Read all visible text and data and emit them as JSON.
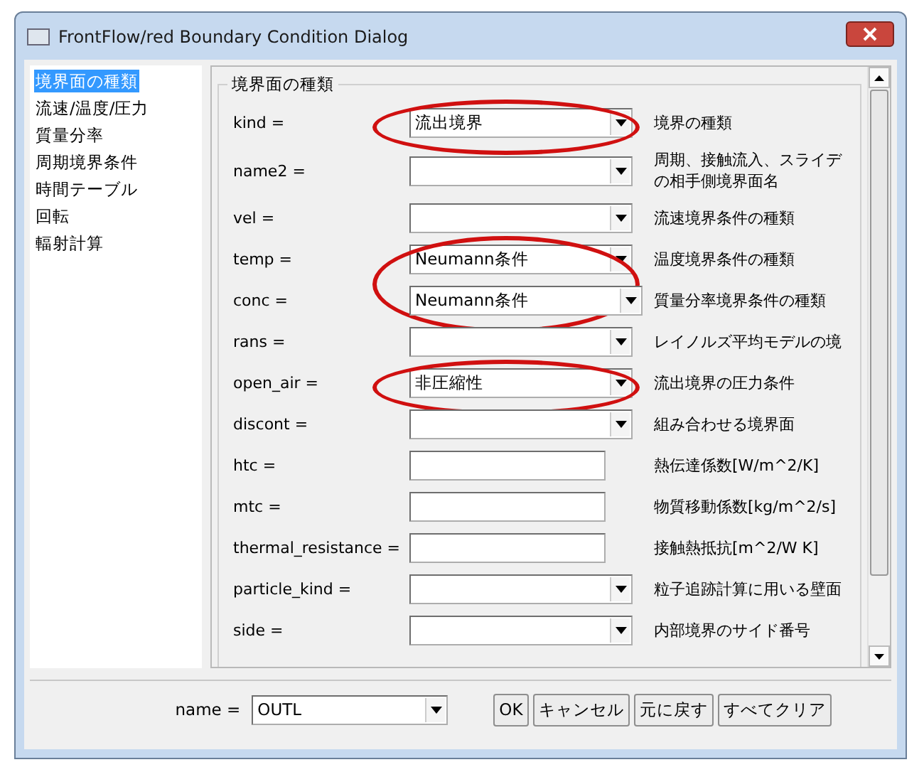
{
  "window": {
    "title": "FrontFlow/red Boundary Condition Dialog"
  },
  "sidebar": {
    "items": [
      {
        "label": "境界面の種類",
        "selected": true
      },
      {
        "label": "流速/温度/圧力",
        "selected": false
      },
      {
        "label": "質量分率",
        "selected": false
      },
      {
        "label": "周期境界条件",
        "selected": false
      },
      {
        "label": "時間テーブル",
        "selected": false
      },
      {
        "label": "回転",
        "selected": false
      },
      {
        "label": "輻射計算",
        "selected": false
      }
    ]
  },
  "group": {
    "title": "境界面の種類",
    "rows": [
      {
        "label": "kind =",
        "kind": "combo",
        "value": "流出境界",
        "description": "境界の種類",
        "circled": true
      },
      {
        "label": "name2 =",
        "kind": "combo",
        "description": "周期、接触流入、スライデの相手側境界面名",
        "circled": false
      },
      {
        "label": "vel =",
        "kind": "combo",
        "description": "流速境界条件の種類",
        "circled": false
      },
      {
        "label": "temp =",
        "kind": "combo",
        "value": "Neumann条件",
        "description": "温度境界条件の種類",
        "circled": true
      },
      {
        "label": "conc =",
        "kind": "combo_wide",
        "value": "Neumann条件",
        "description": "質量分率境界条件の種類",
        "circled": true
      },
      {
        "label": "rans =",
        "kind": "combo",
        "description": "レイノルズ平均モデルの境",
        "circled": false
      },
      {
        "label": "open_air =",
        "kind": "combo",
        "value": "非圧縮性",
        "description": "流出境界の圧力条件",
        "circled": true
      },
      {
        "label": "discont =",
        "kind": "combo",
        "description": "組み合わせる境界面",
        "circled": false
      },
      {
        "label": "htc =",
        "kind": "text",
        "description": "熱伝達係数[W/m^2/K]",
        "circled": false
      },
      {
        "label": "mtc =",
        "kind": "text",
        "description": "物質移動係数[kg/m^2/s]",
        "circled": false
      },
      {
        "label": "thermal_resistance =",
        "kind": "text",
        "description": "接触熱抵抗[m^2/W K]",
        "circled": false
      },
      {
        "label": "particle_kind =",
        "kind": "combo",
        "description": "粒子追跡計算に用いる壁面",
        "circled": false
      },
      {
        "label": "side =",
        "kind": "combo",
        "description": "内部境界のサイド番号",
        "circled": false
      }
    ]
  },
  "footer": {
    "name_label": "name =",
    "name_value": "OUTL",
    "buttons": [
      "OK",
      "キャンセル",
      "元に戻す",
      "すべてクリア"
    ]
  }
}
